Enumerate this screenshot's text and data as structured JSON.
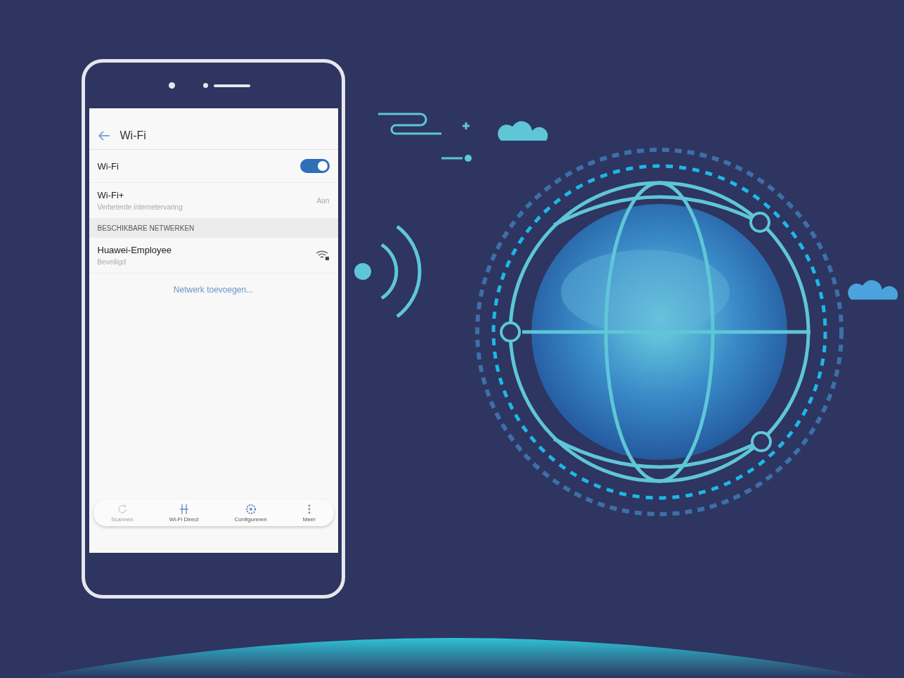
{
  "screen": {
    "title": "Wi-Fi",
    "settings": [
      {
        "kind": "toggle",
        "label": "Wi-Fi",
        "on": true
      },
      {
        "kind": "link",
        "label": "Wi-Fi+",
        "subtitle": "Verbeterde internetervaring",
        "value": "Aan"
      }
    ],
    "section_header": "BESCHIKBARE NETWERKEN",
    "networks": [
      {
        "name": "Huawei-Employee",
        "status": "Beveiligd",
        "secured": true
      }
    ],
    "add_network": "Netwerk toevoegen...",
    "bottom_bar": [
      {
        "kind": "scan",
        "label": "Scannen",
        "disabled": true
      },
      {
        "kind": "direct",
        "label": "Wi-Fi Direct",
        "disabled": false
      },
      {
        "kind": "settings",
        "label": "Configureren",
        "disabled": false
      },
      {
        "kind": "more",
        "label": "Meer",
        "disabled": false
      }
    ]
  }
}
